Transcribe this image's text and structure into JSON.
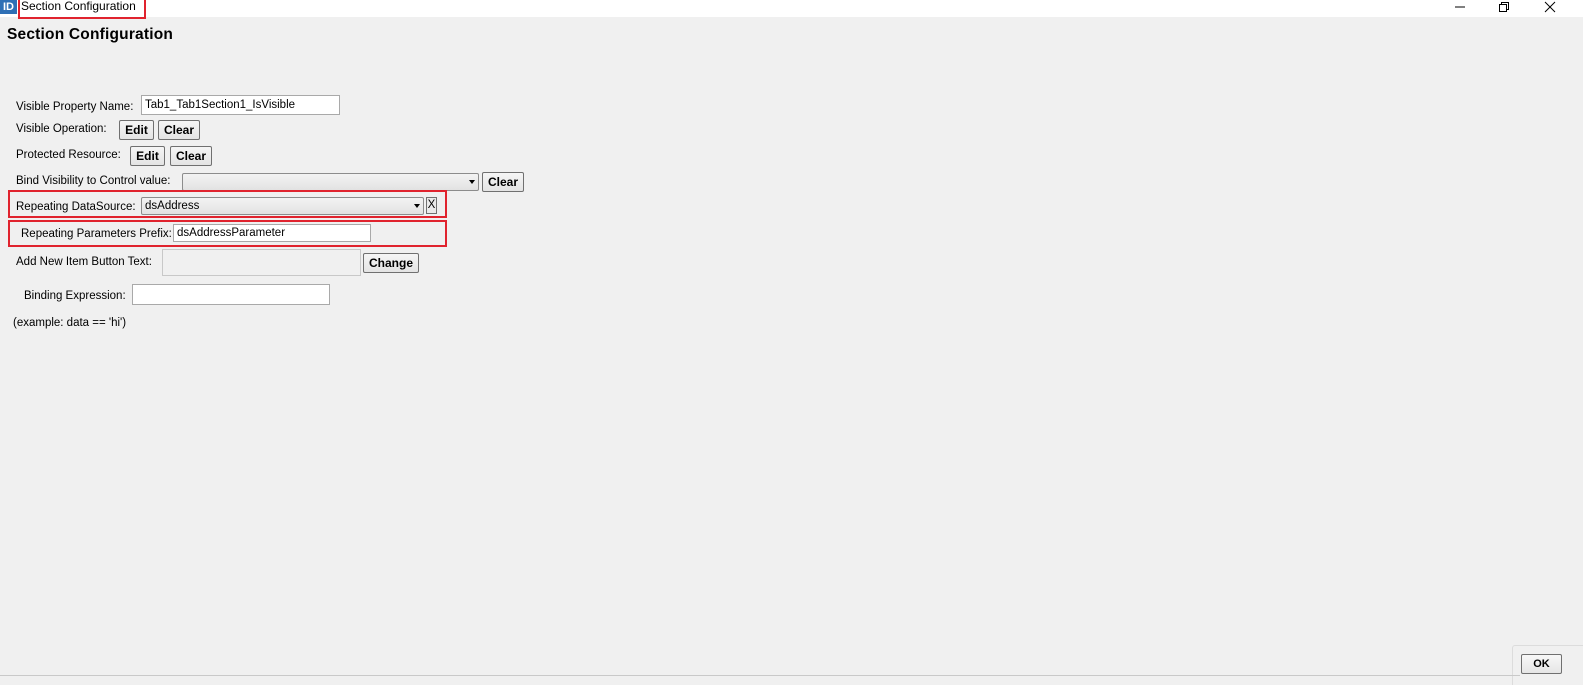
{
  "window": {
    "app_icon_text": "ID",
    "title": "Section Configuration",
    "controls": {
      "minimize": "minimize-icon",
      "restore": "restore-icon",
      "close": "close-icon"
    }
  },
  "heading": "Section Configuration",
  "form": {
    "visible_property_name": {
      "label": "Visible Property Name:",
      "value": "Tab1_Tab1Section1_IsVisible"
    },
    "visible_operation": {
      "label": "Visible Operation:",
      "edit": "Edit",
      "clear": "Clear"
    },
    "protected_resource": {
      "label": "Protected Resource:",
      "edit": "Edit",
      "clear": "Clear"
    },
    "bind_visibility": {
      "label": "Bind Visibility to Control value:",
      "value": "",
      "clear": "Clear"
    },
    "repeating_datasource": {
      "label": "Repeating DataSource:",
      "value": "dsAddress",
      "remove": "X"
    },
    "repeating_prefix": {
      "label": "Repeating Parameters Prefix:",
      "value": "dsAddressParameter"
    },
    "add_new_item": {
      "label": "Add New Item Button Text:",
      "value": "",
      "change": "Change"
    },
    "binding_expression": {
      "label": "Binding Expression:",
      "value": "",
      "example": "(example: data == 'hi')"
    }
  },
  "footer": {
    "ok": "OK"
  },
  "highlight_color": "#e0232e"
}
